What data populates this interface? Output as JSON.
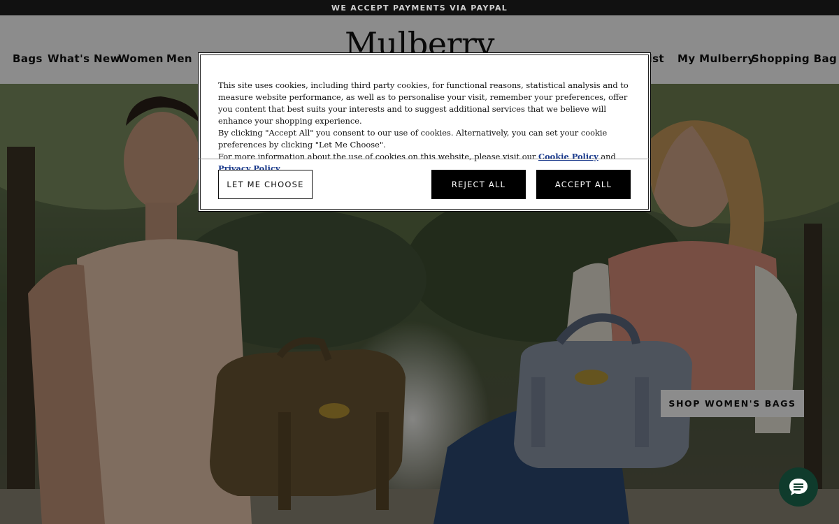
{
  "announcement": {
    "text": "WE ACCEPT PAYMENTS VIA PAYPAL"
  },
  "header": {
    "logo": "Mulberry",
    "nav_left": [
      "Bags",
      "What's New",
      "Women",
      "Men"
    ],
    "nav_right": {
      "wishlist_partial": "list",
      "account": "My Mulberry",
      "bag": "Shopping Bag"
    }
  },
  "hero": {
    "cta_label": "SHOP WOMEN'S BAGS",
    "chat_icon": "chat-bubble-icon"
  },
  "cookie_dialog": {
    "paragraph1": "This site uses cookies, including third party cookies, for functional reasons, statistical analysis and to measure website performance, as well as to personalise your visit, remember your preferences, offer you content that best suits your interests and to suggest additional services that we believe will enhance your shopping experience.",
    "paragraph2": "By clicking \"Accept All\" you consent to our use of cookies. Alternatively, you can set your cookie preferences by clicking \"Let Me Choose\".",
    "paragraph3_prefix": "For more information about the use of cookies on this website, please visit our",
    "cookie_policy_link": "Cookie Policy",
    "and_text": "and",
    "privacy_policy_link": "Privacy Policy",
    "paragraph3_suffix": ".",
    "let_me_choose": "LET ME CHOOSE",
    "reject_all": "REJECT ALL",
    "accept_all": "ACCEPT ALL"
  },
  "colors": {
    "topbar": "#111111",
    "chat_button": "#0f3b2c",
    "link": "#1a3a8c"
  }
}
